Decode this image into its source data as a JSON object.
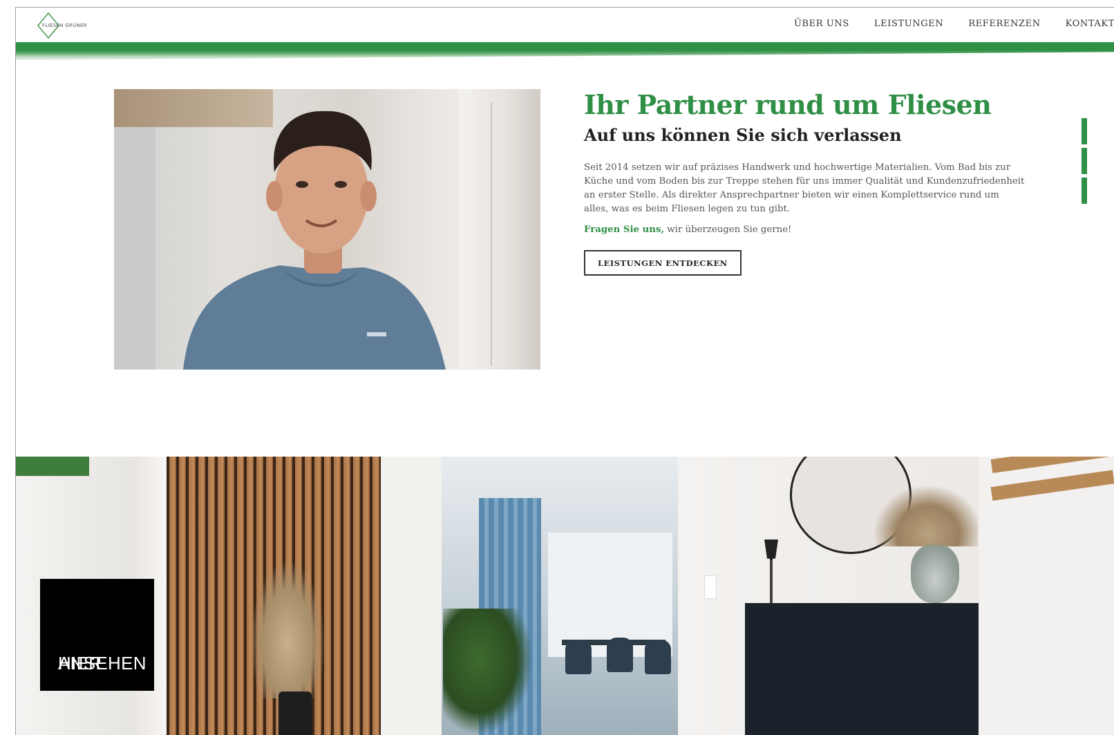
{
  "header": {
    "logo_text": "FLIESEN GRÜNER",
    "nav": [
      "ÜBER UNS",
      "LEISTUNGEN",
      "REFERENZEN",
      "KONTAKT"
    ]
  },
  "hero": {
    "title": "Ihr Partner rund um Fliesen",
    "subtitle": "Auf uns können Sie sich verlassen",
    "body": "Seit 2014 setzen wir auf präzises Handwerk und hochwertige Materialien. Vom Bad bis zur Küche und vom Boden bis zur Treppe stehen für uns immer Qualität und Kundenzufriedenheit an erster Stelle. Als direkter Ansprechpartner bieten wir einen Komplettservice rund um alles, was es beim Fliesen legen zu tun gibt.",
    "cta_highlight": "Fragen Sie uns,",
    "cta_rest": " wir überzeugen Sie gerne!",
    "button_label": "LEISTUNGEN ENTDECKEN"
  },
  "gallery": {
    "promo_label_line1": "HIER",
    "promo_label_line2": "ANSEHEN"
  },
  "colors": {
    "brand_green": "#2e8f45",
    "text_dark": "#222222",
    "promo_bg": "#000000"
  }
}
